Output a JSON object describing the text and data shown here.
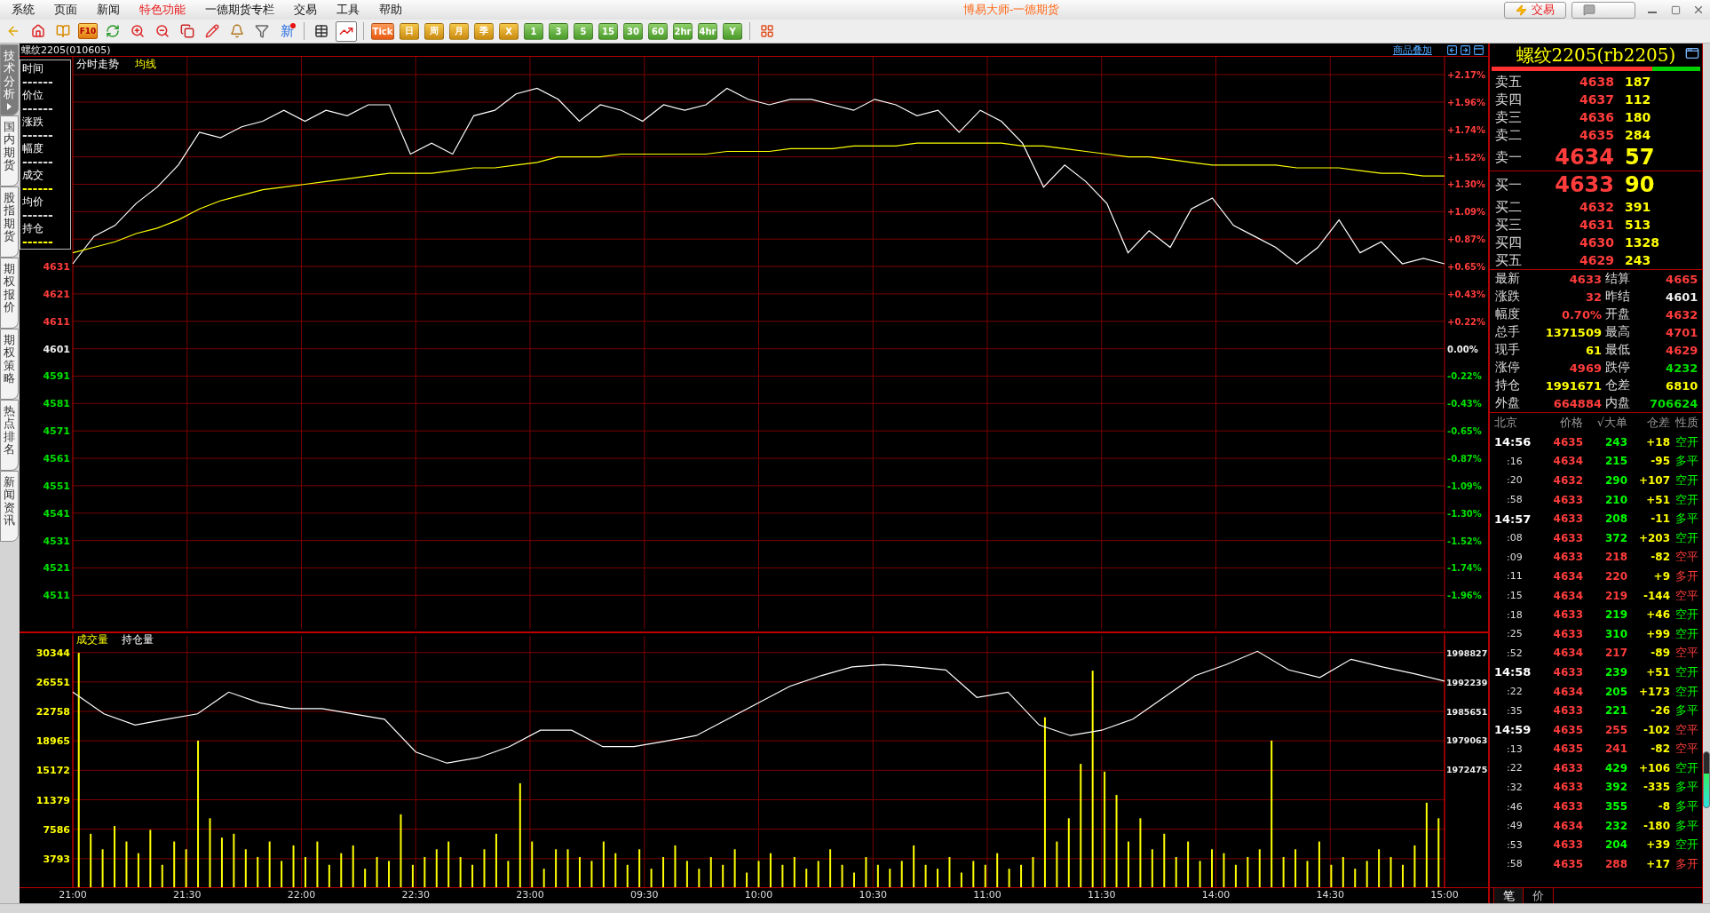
{
  "window": {
    "title": "博易大师-一德期货"
  },
  "menu": [
    {
      "label": "系统",
      "highlighted": false
    },
    {
      "label": "页面",
      "highlighted": false
    },
    {
      "label": "新闻",
      "highlighted": false
    },
    {
      "label": "特色功能",
      "highlighted": true
    },
    {
      "label": "一德期货专栏",
      "highlighted": false
    },
    {
      "label": "交易",
      "highlighted": false
    },
    {
      "label": "工具",
      "highlighted": false
    },
    {
      "label": "帮助",
      "highlighted": false
    }
  ],
  "title_buttons": [
    {
      "kind": "trade",
      "label": "交易"
    },
    {
      "kind": "chat"
    }
  ],
  "toolbar": {
    "left_tools": [
      {
        "kind": "back"
      },
      {
        "kind": "home"
      },
      {
        "kind": "book"
      },
      {
        "kind": "f10",
        "label": "F10"
      },
      {
        "kind": "refresh"
      },
      {
        "kind": "zoom_in"
      },
      {
        "kind": "zoom_out"
      },
      {
        "kind": "windows"
      },
      {
        "kind": "pencil"
      },
      {
        "kind": "bell"
      },
      {
        "kind": "filter"
      },
      {
        "kind": "new",
        "label": "新"
      }
    ],
    "view_tools": [
      {
        "kind": "table",
        "selected": false
      },
      {
        "kind": "chart",
        "selected": true
      }
    ],
    "periods": [
      {
        "label": "Tick",
        "kind": "tick"
      },
      {
        "label": "日",
        "kind": "calendar"
      },
      {
        "label": "周",
        "kind": "calendar"
      },
      {
        "label": "月",
        "kind": "calendar"
      },
      {
        "label": "季",
        "kind": "calendar"
      },
      {
        "label": "X",
        "kind": "calendar"
      },
      {
        "label": "1",
        "kind": "minute"
      },
      {
        "label": "3",
        "kind": "minute"
      },
      {
        "label": "5",
        "kind": "minute"
      },
      {
        "label": "15",
        "kind": "minute"
      },
      {
        "label": "30",
        "kind": "minute"
      },
      {
        "label": "60",
        "kind": "minute"
      },
      {
        "label": "2hr",
        "kind": "minute"
      },
      {
        "label": "4hr",
        "kind": "minute"
      },
      {
        "label": "Y",
        "kind": "minute"
      }
    ],
    "end_tools": [
      {
        "kind": "grid"
      }
    ]
  },
  "side_tabs": [
    {
      "label": "技术分析",
      "selected": true
    },
    {
      "label": "国内期货",
      "selected": false
    },
    {
      "label": "股指期货",
      "selected": false
    },
    {
      "label": "期权报价",
      "selected": false
    },
    {
      "label": "期权策略",
      "selected": false
    },
    {
      "label": "热点排名",
      "selected": false
    },
    {
      "label": "新闻资讯",
      "selected": false
    }
  ],
  "chart_header": {
    "symbol": "螺纹2205(010605)",
    "overlay_link": "商品叠加"
  },
  "price_chart": {
    "legend": [
      {
        "label": "时间",
        "line": "------",
        "color": "#d8d8d8"
      },
      {
        "label": "价位",
        "line": "------",
        "color": "#d8d8d8"
      },
      {
        "label": "涨跌",
        "line": "------",
        "color": "#d8d8d8"
      },
      {
        "label": "幅度",
        "line": "------",
        "color": "#d8d8d8"
      },
      {
        "label": "成交",
        "line": "------",
        "color": "#ffff00"
      },
      {
        "label": "均价",
        "line": "------",
        "color": "#d8d8d8"
      },
      {
        "label": "持仓",
        "line": "------",
        "color": "#ffff00"
      }
    ],
    "pct_labels": [
      {
        "label": "+2.17%",
        "color": "#ff3c3c"
      },
      {
        "label": "+1.96%",
        "color": "#ff3c3c"
      },
      {
        "label": "+1.74%",
        "color": "#ff3c3c"
      },
      {
        "label": "+1.52%",
        "color": "#ff3c3c"
      },
      {
        "label": "+1.30%",
        "color": "#ff3c3c"
      },
      {
        "label": "+1.09%",
        "color": "#ff3c3c"
      },
      {
        "label": "+0.87%",
        "color": "#ff3c3c"
      },
      {
        "label": "+0.65%",
        "color": "#ff3c3c"
      },
      {
        "label": "+0.43%",
        "color": "#ff3c3c"
      },
      {
        "label": "+0.22%",
        "color": "#ff3c3c"
      },
      {
        "label": "0.00%",
        "color": "#eeeeee"
      },
      {
        "label": "-0.22%",
        "color": "#00e000"
      },
      {
        "label": "-0.43%",
        "color": "#00e000"
      },
      {
        "label": "-0.65%",
        "color": "#00e000"
      },
      {
        "label": "-0.87%",
        "color": "#00e000"
      },
      {
        "label": "-1.09%",
        "color": "#00e000"
      },
      {
        "label": "-1.30%",
        "color": "#00e000"
      },
      {
        "label": "-1.52%",
        "color": "#00e000"
      },
      {
        "label": "-1.74%",
        "color": "#00e000"
      },
      {
        "label": "-1.96%",
        "color": "#00e000"
      }
    ],
    "chart_data": {
      "type": "line",
      "ylim": [
        4497.5,
        4707.5
      ],
      "yticks": [
        4631,
        4621,
        4611,
        4601,
        4591,
        4581,
        4571,
        4561,
        4551,
        4541,
        4531,
        4521,
        4511
      ],
      "grid": true,
      "categories": [
        null,
        null,
        null,
        null,
        null,
        null,
        null,
        null,
        null,
        null,
        null,
        null,
        null,
        null,
        null,
        null,
        null,
        null,
        null,
        null,
        null,
        null,
        null,
        null,
        null,
        null,
        null,
        null,
        null,
        null,
        null,
        null,
        null,
        null,
        null,
        null,
        null,
        null,
        null,
        null,
        null,
        null,
        null,
        null,
        null,
        null,
        null,
        null,
        null,
        null,
        null,
        null,
        null,
        null,
        null,
        null,
        null,
        null,
        null,
        null,
        null,
        null,
        null,
        null,
        null,
        null
      ],
      "series": [
        {
          "name": "分时走势",
          "color": "#ffffff",
          "values": [
            4632,
            4642,
            4646,
            4654,
            4660,
            4668,
            4680,
            4678,
            4682,
            4684,
            4688,
            4684,
            4688,
            4686,
            4690,
            4690,
            4672,
            4676,
            4672,
            4686,
            4688,
            4694,
            4696,
            4692,
            4684,
            4690,
            4688,
            4684,
            4690,
            4688,
            4690,
            4696,
            4692,
            4690,
            4692,
            4692,
            4690,
            4688,
            4692,
            4690,
            4686,
            4688,
            4680,
            4688,
            4684,
            4676,
            4660,
            4668,
            4662,
            4654,
            4636,
            4644,
            4638,
            4652,
            4656,
            4646,
            4642,
            4638,
            4632,
            4638,
            4648,
            4636,
            4640,
            4632,
            4634,
            4632
          ]
        },
        {
          "name": "均线",
          "color": "#ffff00",
          "values": [
            4636,
            4638,
            4640,
            4643,
            4645,
            4648,
            4652,
            4655,
            4657,
            4659,
            4660,
            4661,
            4662,
            4663,
            4664,
            4665,
            4665,
            4665,
            4666,
            4667,
            4667,
            4668,
            4669,
            4671,
            4671,
            4671,
            4672,
            4672,
            4672,
            4672,
            4672,
            4673,
            4673,
            4673,
            4674,
            4674,
            4674,
            4675,
            4675,
            4675,
            4676,
            4676,
            4676,
            4676,
            4676,
            4675,
            4675,
            4674,
            4673,
            4672,
            4671,
            4671,
            4670,
            4669,
            4668,
            4668,
            4668,
            4668,
            4667,
            4667,
            4667,
            4666,
            4665,
            4665,
            4664,
            4664
          ]
        }
      ]
    }
  },
  "volume": {
    "chart_data": {
      "type": "bar",
      "ylim": [
        0,
        32937
      ],
      "yticks": [
        3793,
        7586,
        11379,
        15172,
        18965,
        22758,
        26551,
        30344
      ],
      "grid": true,
      "categories": [
        null,
        null,
        null,
        null,
        null,
        null,
        null,
        null,
        null,
        null,
        null,
        null,
        null,
        null,
        null,
        null,
        null,
        null,
        null,
        null,
        null,
        null,
        null,
        null,
        null,
        null,
        null,
        null,
        null,
        null,
        null,
        null,
        null,
        null,
        null,
        null,
        null,
        null,
        null,
        null,
        null,
        null,
        null,
        null,
        null,
        null,
        null,
        null,
        null,
        null,
        null,
        null,
        null,
        null,
        null,
        null,
        null,
        null,
        null,
        null,
        null,
        null,
        null,
        null,
        null,
        null,
        null,
        null,
        null,
        null,
        null,
        null,
        null,
        null,
        null,
        null,
        null,
        null,
        null,
        null,
        null,
        null,
        null,
        null,
        null,
        null,
        null,
        null,
        null,
        null,
        null,
        null,
        null,
        null,
        null,
        null,
        null,
        null,
        null,
        null,
        null,
        null,
        null,
        null,
        null,
        null,
        null,
        null,
        null,
        null,
        null,
        null,
        null,
        null,
        null
      ],
      "series": [
        {
          "name": "成交量",
          "color": "#ffff00",
          "values": [
            30300,
            7000,
            5000,
            8000,
            6000,
            4500,
            7500,
            3000,
            6000,
            5000,
            19000,
            9000,
            6500,
            7000,
            5000,
            4000,
            6000,
            3500,
            5500,
            4000,
            6000,
            3000,
            4500,
            5500,
            2500,
            4000,
            3500,
            9500,
            3000,
            4000,
            5000,
            6000,
            4000,
            3000,
            5000,
            7000,
            3500,
            13500,
            6000,
            2500,
            5000,
            5000,
            4000,
            3500,
            6000,
            4500,
            3000,
            5000,
            2500,
            4000,
            5500,
            3500,
            2500,
            4000,
            3000,
            5000,
            2000,
            3500,
            4500,
            3000,
            4000,
            2500,
            3500,
            5000,
            3000,
            2000,
            4000,
            3000,
            2500,
            3500,
            5500,
            3000,
            2500,
            4000,
            2000,
            3500,
            3000,
            4500,
            2500,
            3000,
            4000,
            22000,
            6000,
            9000,
            16000,
            28000,
            15000,
            12000,
            6000,
            9000,
            5000,
            7000,
            4000,
            6000,
            3500,
            5000,
            4500,
            3000,
            4000,
            5000,
            19000,
            4000,
            5000,
            3500,
            6000,
            3000,
            4000,
            2500,
            3500,
            5000,
            4000,
            3000,
            5500,
            11000,
            9000
          ]
        }
      ]
    }
  },
  "time_axis": [
    "21:00",
    "21:30",
    "22:00",
    "22:30",
    "23:00",
    "09:30",
    "10:00",
    "10:30",
    "11:00",
    "11:30",
    "14:00",
    "14:30",
    "15:00"
  ],
  "open_interest": {
    "chart_data": {
      "type": "line",
      "ylim": [
        1945722,
        2003366
      ],
      "yticks": [
        1972475,
        1979063,
        1985651,
        1992239,
        1998827
      ],
      "categories": [
        null,
        null,
        null,
        null,
        null,
        null,
        null,
        null,
        null,
        null,
        null,
        null,
        null,
        null,
        null,
        null,
        null,
        null,
        null,
        null,
        null,
        null,
        null,
        null,
        null,
        null,
        null,
        null,
        null,
        null,
        null,
        null,
        null,
        null,
        null,
        null,
        null,
        null,
        null,
        null,
        null,
        null,
        null,
        null,
        null
      ],
      "series": [
        {
          "name": "持仓量",
          "color": "#ffffff",
          "values": [
            1989900,
            1985000,
            1982500,
            1983800,
            1985000,
            1989900,
            1987500,
            1986200,
            1986200,
            1985000,
            1983800,
            1976400,
            1973900,
            1975100,
            1977600,
            1981300,
            1981300,
            1977600,
            1977600,
            1978800,
            1980100,
            1983800,
            1987500,
            1991200,
            1993600,
            1995600,
            1996100,
            1995600,
            1994900,
            1988700,
            1989900,
            1982500,
            1980100,
            1981300,
            1983800,
            1988700,
            1993600,
            1996100,
            1999100,
            1994900,
            1993200,
            1997300,
            1995600,
            1994100,
            1992400
          ]
        }
      ]
    }
  },
  "quote_panel": {
    "title": "螺纹2205(rb2205)",
    "buy_ratio": {
      "level": 0.77
    },
    "asks": [
      {
        "label": "卖五",
        "price": "4638",
        "volume": "187",
        "kind": "level"
      },
      {
        "label": "卖四",
        "price": "4637",
        "volume": "112",
        "kind": "level"
      },
      {
        "label": "卖三",
        "price": "4636",
        "volume": "180",
        "kind": "level"
      },
      {
        "label": "卖二",
        "price": "4635",
        "volume": "284",
        "kind": "level"
      },
      {
        "label": "卖一",
        "price": "4634",
        "volume": "57",
        "kind": "best"
      }
    ],
    "bids": [
      {
        "label": "买一",
        "price": "4633",
        "volume": "90",
        "kind": "best"
      },
      {
        "label": "买二",
        "price": "4632",
        "volume": "391",
        "kind": "level"
      },
      {
        "label": "买三",
        "price": "4631",
        "volume": "513",
        "kind": "level"
      },
      {
        "label": "买四",
        "price": "4630",
        "volume": "1328",
        "kind": "level"
      },
      {
        "label": "买五",
        "price": "4629",
        "volume": "243",
        "kind": "level"
      }
    ],
    "stats": [
      {
        "label": "最新",
        "value": "4633",
        "color": "#ff3c3c"
      },
      {
        "label": "结算",
        "value": "4665",
        "color": "#ff3c3c"
      },
      {
        "label": "涨跌",
        "value": "32",
        "color": "#ff3c3c"
      },
      {
        "label": "昨结",
        "value": "4601",
        "color": "#eeeeee"
      },
      {
        "label": "幅度",
        "value": "0.70%",
        "color": "#ff3c3c"
      },
      {
        "label": "开盘",
        "value": "4632",
        "color": "#ff3c3c"
      },
      {
        "label": "总手",
        "value": "1371509",
        "color": "#ffff00"
      },
      {
        "label": "最高",
        "value": "4701",
        "color": "#ff3c3c"
      },
      {
        "label": "现手",
        "value": "61",
        "color": "#ffff00"
      },
      {
        "label": "最低",
        "value": "4629",
        "color": "#ff3c3c"
      },
      {
        "label": "涨停",
        "value": "4969",
        "color": "#ff3c3c"
      },
      {
        "label": "跌停",
        "value": "4232",
        "color": "#00e000"
      },
      {
        "label": "持仓",
        "value": "1991671",
        "color": "#ffff00"
      },
      {
        "label": "仓差",
        "value": "6810",
        "color": "#ffff00"
      },
      {
        "label": "外盘",
        "value": "664884",
        "color": "#ff3c3c"
      },
      {
        "label": "内盘",
        "value": "706624",
        "color": "#00e000"
      }
    ],
    "trades_header": [
      "北京",
      "价格",
      "√大单",
      "仓差",
      "性质"
    ],
    "trades": [
      {
        "time": "14:56",
        "kind": "minute",
        "price": "4635",
        "volume": "243",
        "oi_change": "+18",
        "nature": "空开",
        "color": "#00ff00"
      },
      {
        "time": ":16",
        "kind": "second",
        "price": "4634",
        "volume": "215",
        "oi_change": "-95",
        "nature": "多平",
        "color": "#00ff00"
      },
      {
        "time": ":20",
        "kind": "second",
        "price": "4632",
        "volume": "290",
        "oi_change": "+107",
        "nature": "空开",
        "color": "#00ff00"
      },
      {
        "time": ":58",
        "kind": "second",
        "price": "4633",
        "volume": "210",
        "oi_change": "+51",
        "nature": "空开",
        "color": "#00ff00"
      },
      {
        "time": "14:57",
        "kind": "minute",
        "price": "4633",
        "volume": "208",
        "oi_change": "-11",
        "nature": "多平",
        "color": "#00ff00"
      },
      {
        "time": ":08",
        "kind": "second",
        "price": "4633",
        "volume": "372",
        "oi_change": "+203",
        "nature": "空开",
        "color": "#00ff00"
      },
      {
        "time": ":09",
        "kind": "second",
        "price": "4633",
        "volume": "218",
        "oi_change": "-82",
        "nature": "空平",
        "color": "#ff3c3c"
      },
      {
        "time": ":11",
        "kind": "second",
        "price": "4634",
        "volume": "220",
        "oi_change": "+9",
        "nature": "多开",
        "color": "#ff3c3c"
      },
      {
        "time": ":15",
        "kind": "second",
        "price": "4634",
        "volume": "219",
        "oi_change": "-144",
        "nature": "空平",
        "color": "#ff3c3c"
      },
      {
        "time": ":18",
        "kind": "second",
        "price": "4633",
        "volume": "219",
        "oi_change": "+46",
        "nature": "空开",
        "color": "#00ff00"
      },
      {
        "time": ":25",
        "kind": "second",
        "price": "4633",
        "volume": "310",
        "oi_change": "+99",
        "nature": "空开",
        "color": "#00ff00"
      },
      {
        "time": ":52",
        "kind": "second",
        "price": "4634",
        "volume": "217",
        "oi_change": "-89",
        "nature": "空平",
        "color": "#ff3c3c"
      },
      {
        "time": "14:58",
        "kind": "minute",
        "price": "4633",
        "volume": "239",
        "oi_change": "+51",
        "nature": "空开",
        "color": "#00ff00"
      },
      {
        "time": ":22",
        "kind": "second",
        "price": "4634",
        "volume": "205",
        "oi_change": "+173",
        "nature": "空开",
        "color": "#00ff00"
      },
      {
        "time": ":35",
        "kind": "second",
        "price": "4633",
        "volume": "221",
        "oi_change": "-26",
        "nature": "多平",
        "color": "#00ff00"
      },
      {
        "time": "14:59",
        "kind": "minute",
        "price": "4635",
        "volume": "255",
        "oi_change": "-102",
        "nature": "空平",
        "color": "#ff3c3c"
      },
      {
        "time": ":13",
        "kind": "second",
        "price": "4635",
        "volume": "241",
        "oi_change": "-82",
        "nature": "空平",
        "color": "#ff3c3c"
      },
      {
        "time": ":22",
        "kind": "second",
        "price": "4633",
        "volume": "429",
        "oi_change": "+106",
        "nature": "空开",
        "color": "#00ff00"
      },
      {
        "time": ":32",
        "kind": "second",
        "price": "4633",
        "volume": "392",
        "oi_change": "-335",
        "nature": "多平",
        "color": "#00ff00"
      },
      {
        "time": ":46",
        "kind": "second",
        "price": "4633",
        "volume": "355",
        "oi_change": "-8",
        "nature": "多平",
        "color": "#00ff00"
      },
      {
        "time": ":49",
        "kind": "second",
        "price": "4634",
        "volume": "232",
        "oi_change": "-180",
        "nature": "多平",
        "color": "#00ff00"
      },
      {
        "time": ":53",
        "kind": "second",
        "price": "4633",
        "volume": "204",
        "oi_change": "+39",
        "nature": "空开",
        "color": "#00ff00"
      },
      {
        "time": ":58",
        "kind": "second",
        "price": "4635",
        "volume": "288",
        "oi_change": "+17",
        "nature": "多开",
        "color": "#ff3c3c"
      }
    ],
    "tabs": [
      {
        "label": "笔",
        "selected": true
      },
      {
        "label": "价",
        "selected": false
      }
    ],
    "scroll_meter": {
      "level": 0.62
    }
  }
}
